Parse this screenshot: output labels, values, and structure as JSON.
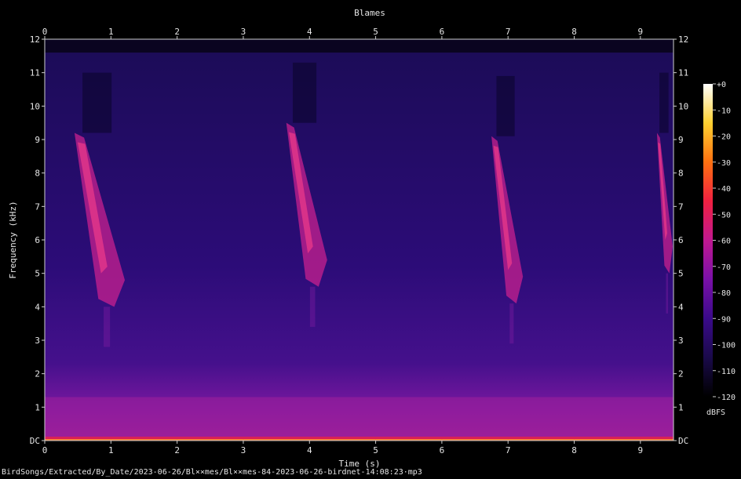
{
  "chart_data": {
    "type": "heatmap",
    "title": "Blames",
    "xlabel": "Time (s)",
    "ylabel": "Frequency (kHz)",
    "xlim": [
      0,
      9.5
    ],
    "ylim": [
      0,
      12
    ],
    "x_ticks": [
      {
        "v": 0,
        "label": "0"
      },
      {
        "v": 1,
        "label": "1"
      },
      {
        "v": 2,
        "label": "2"
      },
      {
        "v": 3,
        "label": "3"
      },
      {
        "v": 4,
        "label": "4"
      },
      {
        "v": 5,
        "label": "5"
      },
      {
        "v": 6,
        "label": "6"
      },
      {
        "v": 7,
        "label": "7"
      },
      {
        "v": 8,
        "label": "8"
      },
      {
        "v": 9,
        "label": "9"
      }
    ],
    "y_ticks": [
      {
        "v": 0,
        "label": "DC"
      },
      {
        "v": 1,
        "label": "1"
      },
      {
        "v": 2,
        "label": "2"
      },
      {
        "v": 3,
        "label": "3"
      },
      {
        "v": 4,
        "label": "4"
      },
      {
        "v": 5,
        "label": "5"
      },
      {
        "v": 6,
        "label": "6"
      },
      {
        "v": 7,
        "label": "7"
      },
      {
        "v": 8,
        "label": "8"
      },
      {
        "v": 9,
        "label": "9"
      },
      {
        "v": 10,
        "label": "10"
      },
      {
        "v": 11,
        "label": "11"
      },
      {
        "v": 12,
        "label": "12"
      }
    ],
    "colorbar": {
      "label": "dBFS",
      "range": [
        -120,
        0
      ],
      "ticks": [
        {
          "v": 0,
          "label": "+0"
        },
        {
          "v": -10,
          "label": "-10"
        },
        {
          "v": -20,
          "label": "-20"
        },
        {
          "v": -30,
          "label": "-30"
        },
        {
          "v": -40,
          "label": "-40"
        },
        {
          "v": -50,
          "label": "-50"
        },
        {
          "v": -60,
          "label": "-60"
        },
        {
          "v": -70,
          "label": "-70"
        },
        {
          "v": -80,
          "label": "-80"
        },
        {
          "v": -90,
          "label": "-90"
        },
        {
          "v": -100,
          "label": "-100"
        },
        {
          "v": -110,
          "label": "-110"
        },
        {
          "v": -120,
          "label": "-120"
        }
      ],
      "colors": [
        "#000000",
        "#1a0a4a",
        "#3a0a8a",
        "#7a10a8",
        "#c01890",
        "#f02040",
        "#ff7010",
        "#ffd030",
        "#ffffff"
      ]
    },
    "calls": [
      {
        "t_start": 0.45,
        "t_end": 1.25,
        "f_high": 9.2,
        "f_low": 4.0,
        "level_db": -62
      },
      {
        "t_start": 3.65,
        "t_end": 4.3,
        "f_high": 9.5,
        "f_low": 4.6,
        "level_db": -58
      },
      {
        "t_start": 6.75,
        "t_end": 7.25,
        "f_high": 9.1,
        "f_low": 4.1,
        "level_db": -60
      },
      {
        "t_start": 9.25,
        "t_end": 9.5,
        "f_high": 9.2,
        "f_low": 5.0,
        "level_db": -62
      }
    ],
    "low_band": {
      "f_high": 1.3,
      "level_db": -70
    },
    "noise_ceiling_khz": 11.6
  },
  "footer": "BirdSongs/Extracted/By_Date/2023-06-26/Bl××mes/Bl××mes-84-2023-06-26-birdnet-14:08:23·mp3"
}
